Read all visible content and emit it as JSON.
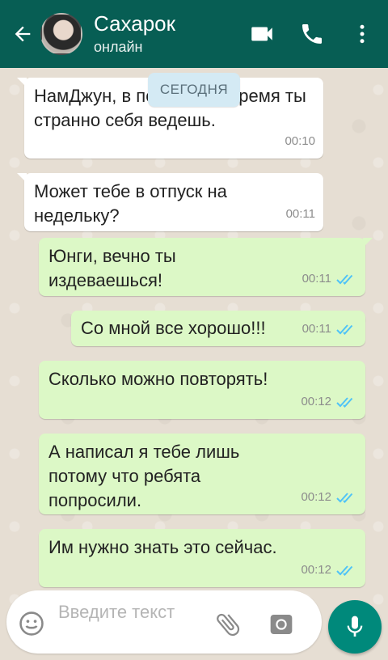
{
  "header": {
    "contact_name": "Сахарок",
    "status": "онлайн",
    "icons": [
      "back-arrow-icon",
      "video-call-icon",
      "phone-icon",
      "more-vert-icon"
    ]
  },
  "date_chip": "СЕГОДНЯ",
  "messages": [
    {
      "direction": "in",
      "text": "НамДжун, в последнее время ты странно себя ведешь.",
      "time": "00:10"
    },
    {
      "direction": "in",
      "text": "Может тебе в отпуск на недельку?",
      "time": "00:11"
    },
    {
      "direction": "out",
      "text": "Юнги, вечно ты издеваешься!",
      "time": "00:11",
      "read": true
    },
    {
      "direction": "out",
      "text": "Со мной все хорошо!!!",
      "time": "00:11",
      "read": true
    },
    {
      "direction": "out",
      "text": "Сколько можно повторять!",
      "time": "00:12",
      "read": true
    },
    {
      "direction": "out",
      "text": "А написал я тебе лишь потому что ребята попросили.",
      "time": "00:12",
      "read": true
    },
    {
      "direction": "out",
      "text": "Им нужно знать это сейчас.",
      "time": "00:12",
      "read": true
    }
  ],
  "composer": {
    "placeholder": "Введите текст",
    "icons": [
      "emoji-icon",
      "attach-icon",
      "camera-icon",
      "mic-icon"
    ]
  },
  "colors": {
    "header": "#075e54",
    "outgoing_bubble": "#dcf8c6",
    "incoming_bubble": "#ffffff",
    "read_ticks": "#4fc3f7",
    "mic_button": "#00897b",
    "date_chip": "#d4eaf4"
  }
}
